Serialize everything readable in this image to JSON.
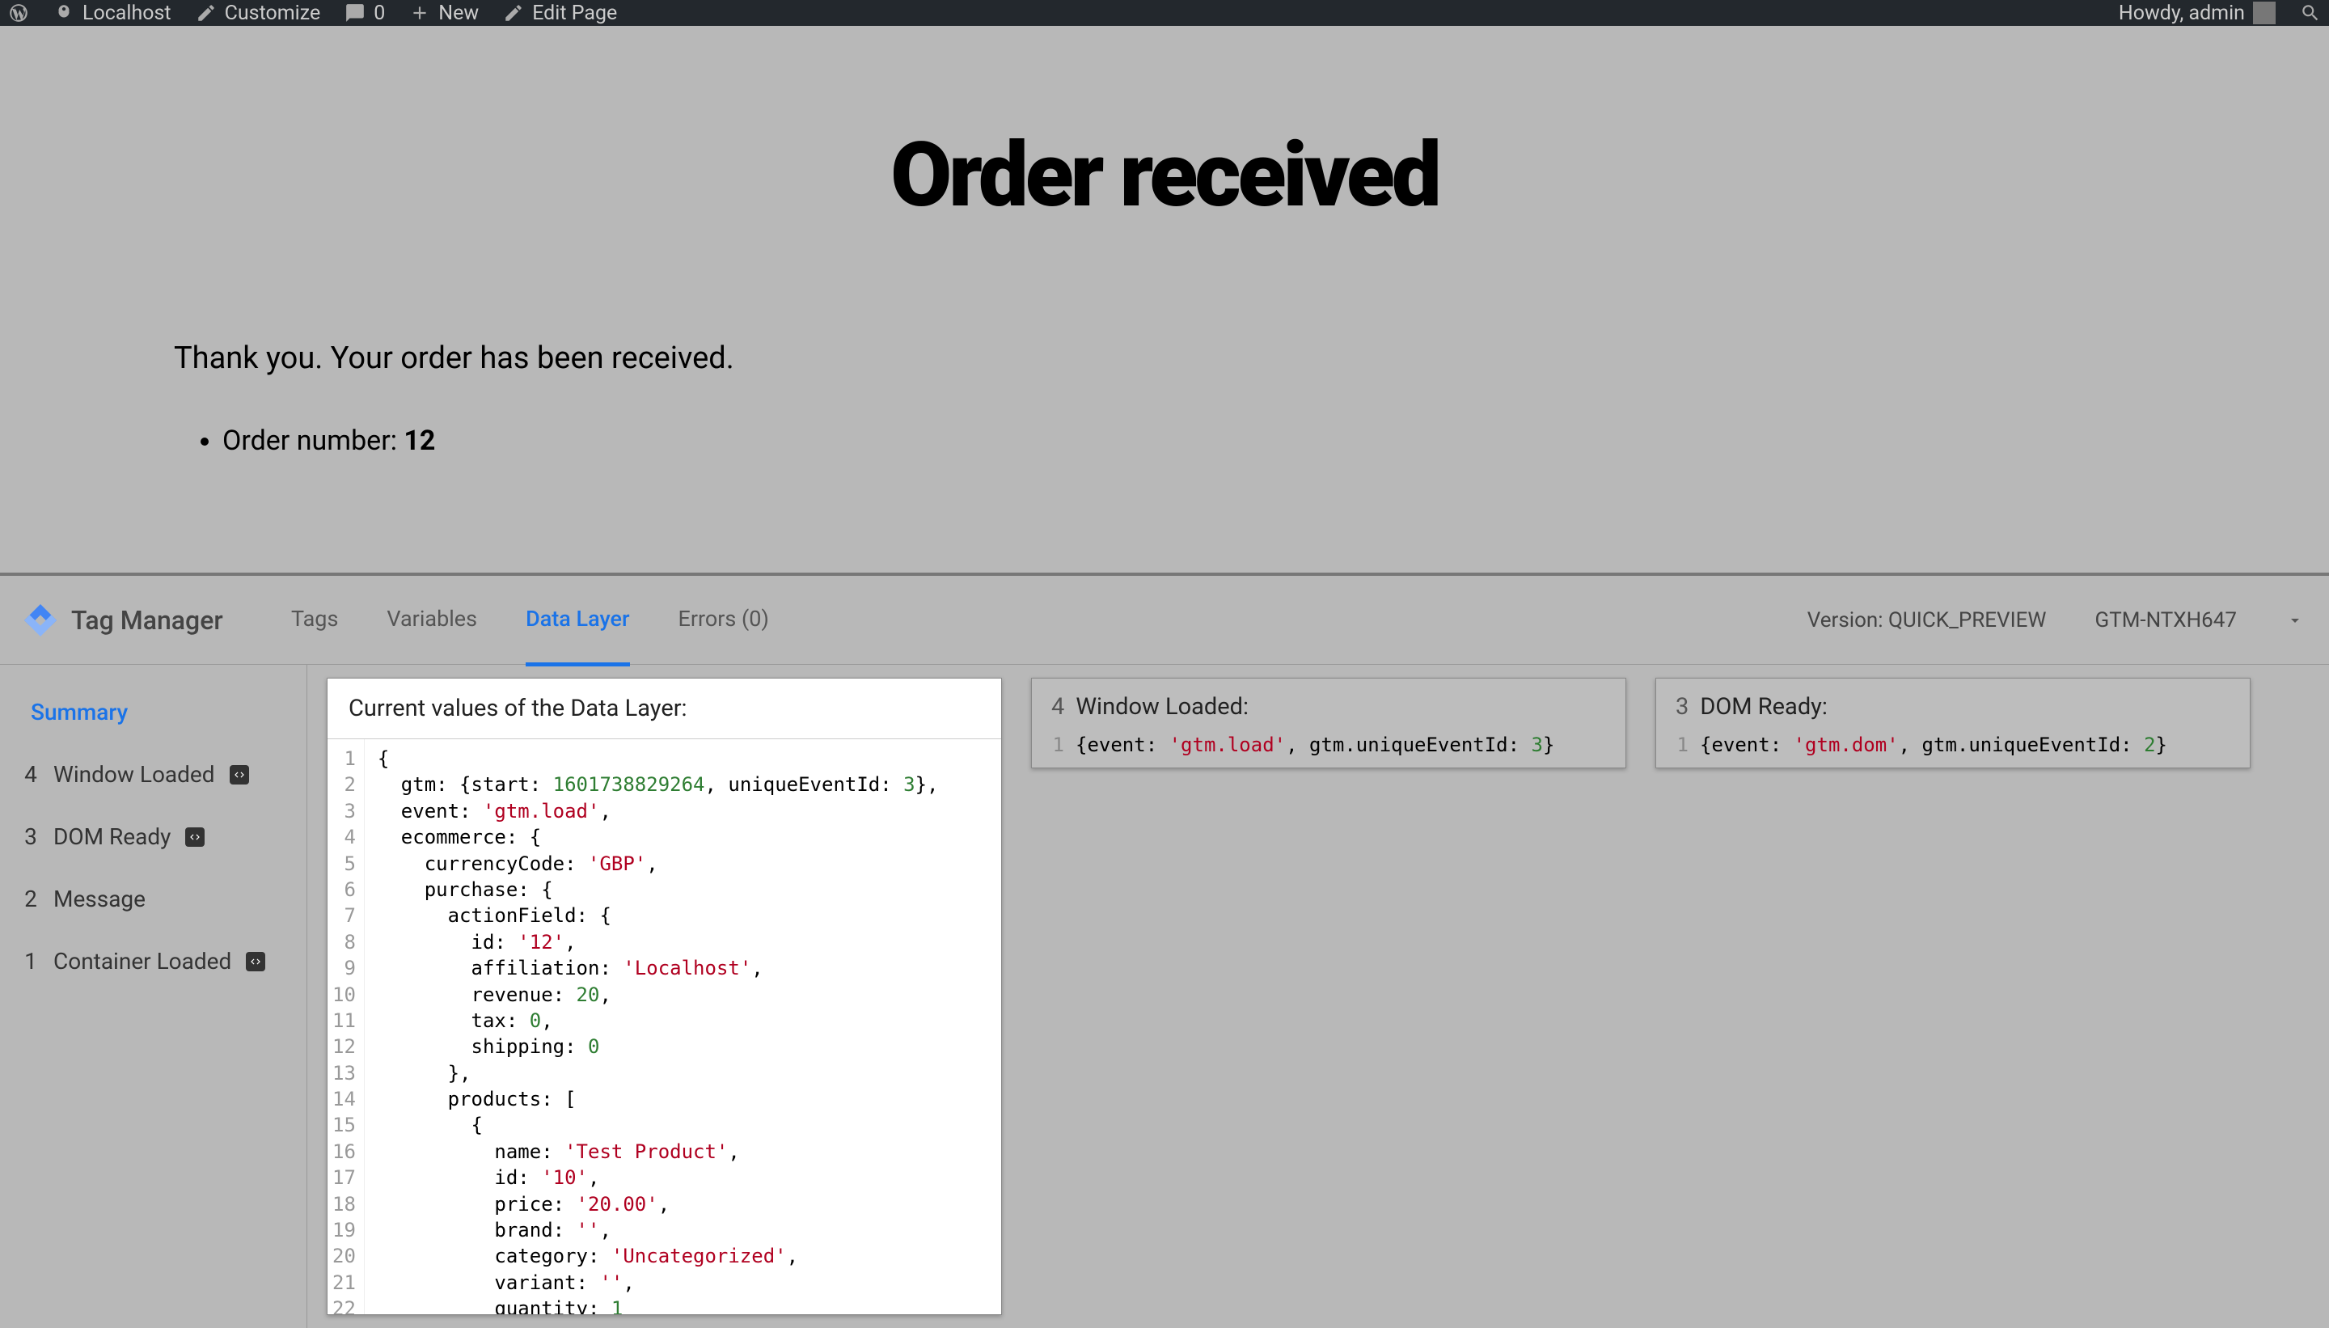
{
  "wp_bar": {
    "site": "Localhost",
    "customize": "Customize",
    "comments": "0",
    "new": "New",
    "edit": "Edit Page",
    "howdy": "Howdy, admin"
  },
  "page": {
    "title": "Order received",
    "message": "Thank you. Your order has been received.",
    "order_label": "Order number: ",
    "order_number": "12"
  },
  "gtm": {
    "product": "Tag Manager",
    "tabs": [
      "Tags",
      "Variables",
      "Data Layer",
      "Errors (0)"
    ],
    "active_tab": "Data Layer",
    "version_label": "Version: QUICK_PREVIEW",
    "container": "GTM-NTXH647",
    "sidebar": {
      "summary": "Summary",
      "items": [
        {
          "num": "4",
          "label": "Window Loaded",
          "badge": true
        },
        {
          "num": "3",
          "label": "DOM Ready",
          "badge": true
        },
        {
          "num": "2",
          "label": "Message",
          "badge": false
        },
        {
          "num": "1",
          "label": "Container Loaded",
          "badge": true
        }
      ]
    },
    "card_main_title": "Current values of the Data Layer:",
    "mini_cards": [
      {
        "num": "4",
        "title": "Window Loaded:",
        "event": "gtm.load",
        "uid": "3"
      },
      {
        "num": "3",
        "title": "DOM Ready:",
        "event": "gtm.dom",
        "uid": "2"
      }
    ],
    "data_layer": {
      "gtm": {
        "start": 1601738829264,
        "uniqueEventId": 3
      },
      "event": "gtm.load",
      "ecommerce": {
        "currencyCode": "GBP",
        "purchase": {
          "actionField": {
            "id": "12",
            "affiliation": "Localhost",
            "revenue": 20,
            "tax": 0,
            "shipping": 0
          },
          "products": [
            {
              "name": "Test Product",
              "id": "10",
              "price": "20.00",
              "brand": "",
              "category": "Uncategorized",
              "variant": "",
              "quantity": 1
            }
          ]
        }
      }
    }
  }
}
